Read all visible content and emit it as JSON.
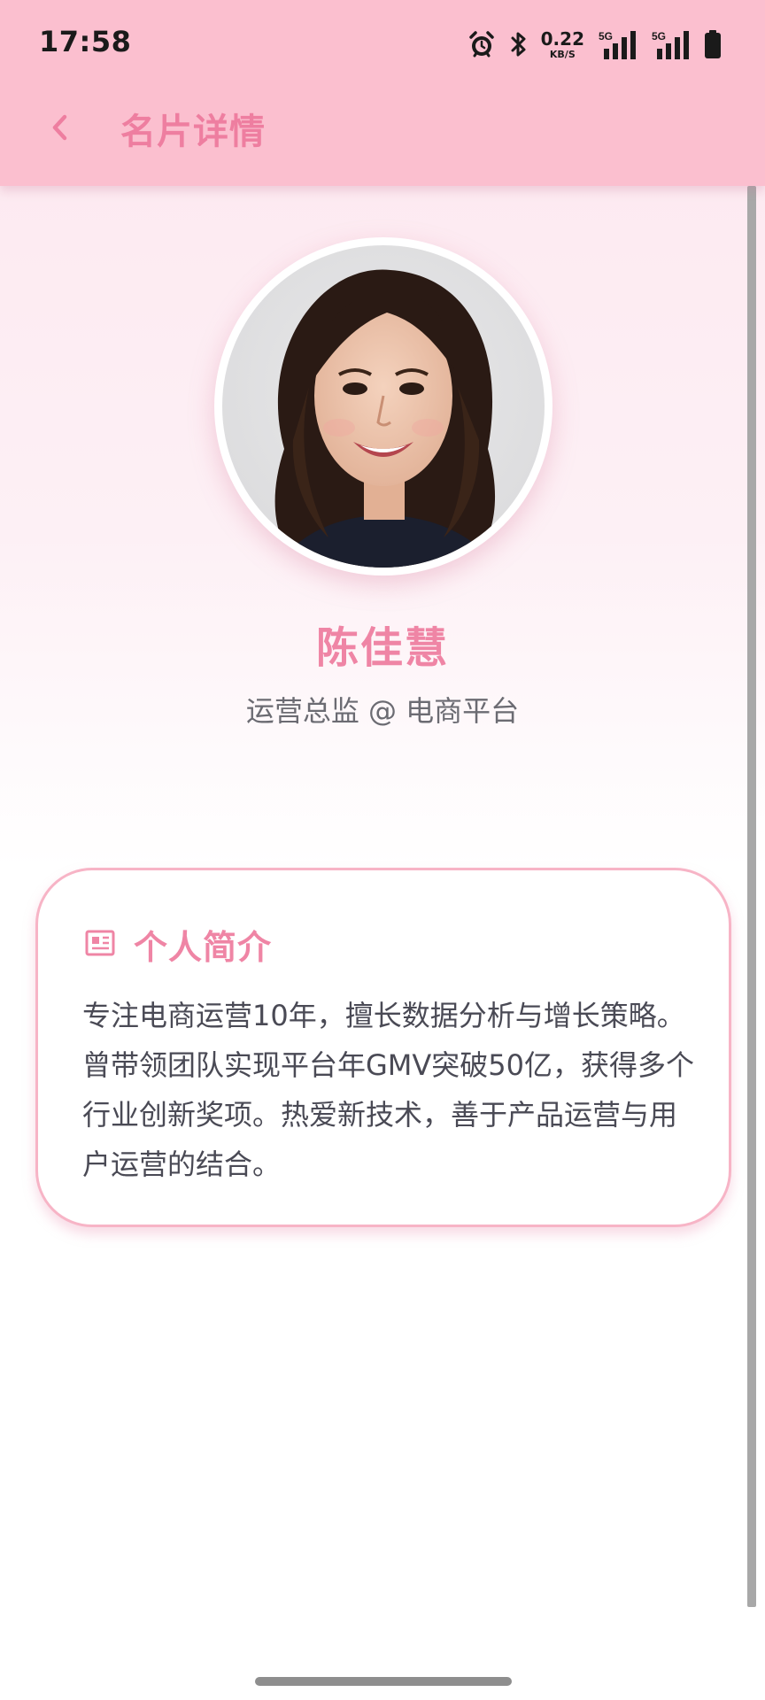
{
  "status_bar": {
    "time": "17:58",
    "net_speed_value": "0.22",
    "net_speed_unit": "KB/S",
    "network_1": "5G",
    "network_2": "5G",
    "icons": [
      "alarm-icon",
      "bluetooth-icon",
      "signal-icon",
      "signal-icon",
      "battery-icon"
    ]
  },
  "header": {
    "back_icon": "chevron-left-icon",
    "title": "名片详情"
  },
  "profile": {
    "name": "陈佳慧",
    "role": "运营总监 @ 电商平台"
  },
  "bio_card": {
    "icon": "newspaper-icon",
    "title": "个人简介",
    "text": "专注电商运营10年，擅长数据分析与增长策略。曾带领团队实现平台年GMV突破50亿，获得多个行业创新奖项。热爱新技术，善于产品运营与用户运营的结合。"
  },
  "colors": {
    "header_bg": "#fbbfcf",
    "accent": "#ef85a5",
    "card_border": "#f7b4c6",
    "body_text": "#4a4a55"
  }
}
